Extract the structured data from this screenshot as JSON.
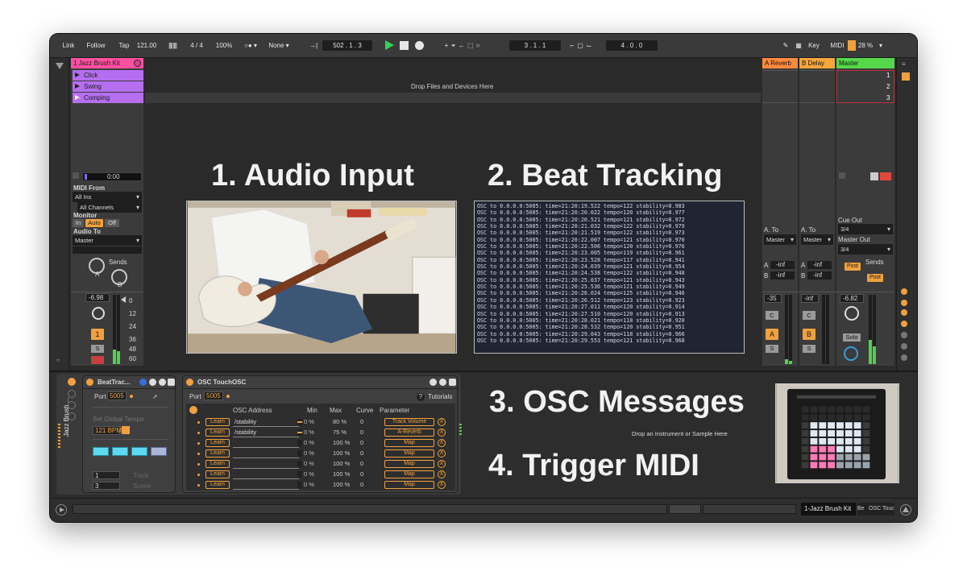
{
  "transport": {
    "link": "Link",
    "follow": "Follow",
    "tap": "Tap",
    "tempo": "121.00",
    "bars": "||||  ||||",
    "signature": "4 / 4",
    "zoom": "100%",
    "metro": "1 Bar",
    "quant": "None",
    "position": "502 .  1 .  3",
    "loop_start": "3 .  1 .  1",
    "loop_len": "4 .  0 .  0",
    "key": "Key",
    "midi": "MIDI",
    "cpu": "28 %"
  },
  "tracks": {
    "midi_track_name": "1 Jazz Brush Kit",
    "clips": [
      "Click",
      "Swing",
      "Comping"
    ],
    "drop_files": "Drop Files and Devices Here",
    "time": "0:00",
    "midi_from": "MIDI From",
    "all_ins": "All Ins",
    "all_channels": "All Channels",
    "monitor": "Monitor",
    "mon_in": "In",
    "mon_auto": "Auto",
    "mon_off": "Off",
    "audio_to": "Audio To",
    "master": "Master",
    "sends": "Sends",
    "send_a": "A",
    "send_b": "B",
    "vol": "-6.98",
    "track_num": "1",
    "solo": "S",
    "scale": [
      "0",
      "12",
      "24",
      "36",
      "48",
      "60"
    ]
  },
  "returns": {
    "a_name": "A Reverb",
    "b_name": "B Delay",
    "master_name": "Master",
    "scene_nums": [
      "1",
      "2",
      "3"
    ],
    "a_to": "A. To",
    "master": "Master",
    "inf": "-inf",
    "a_vol": "-35",
    "b_vol": "-inf",
    "master_vol": "-6.82",
    "a_letter": "A",
    "b_letter": "B",
    "c": "C",
    "s": "S",
    "cue_out": "Cue Out",
    "cue_val": "3/4",
    "master_out": "Master Out",
    "master_out_val": "3/4",
    "sends": "Sends",
    "post": "Post",
    "solo": "Solo",
    "send_a": "A",
    "send_b": "B"
  },
  "overlay": {
    "title1": "1. Audio Input",
    "title2": "2. Beat Tracking",
    "title3": "3. OSC Messages",
    "title4": "4. Trigger MIDI"
  },
  "osc_log": [
    "OSC to 0.0.0.0:5005: time=21:20:19.522 tempo=122 stability=0.983",
    "OSC to 0.0.0.0:5005: time=21:20:20.022 tempo=120 stability=0.977",
    "OSC to 0.0.0.0:5005: time=21:20:20.521 tempo=121 stability=0.972",
    "OSC to 0.0.0.0:5005: time=21:20:21.032 tempo=122 stability=0.979",
    "OSC to 0.0.0.0:5005: time=21:20:21.519 tempo=122 stability=0.973",
    "OSC to 0.0.0.0:5005: time=21:20:22.007 tempo=121 stability=0.970",
    "OSC to 0.0.0.0:5005: time=21:20:22.506 tempo=120 stability=0.976",
    "OSC to 0.0.0.0:5005: time=21:20:23.005 tempo=119 stability=0.961",
    "OSC to 0.0.0.0:5005: time=21:20:23.528 tempo=117 stability=0.941",
    "OSC to 0.0.0.0:5005: time=21:20:24.039 tempo=121 stability=0.954",
    "OSC to 0.0.0.0:5005: time=21:20:24.538 tempo=122 stability=0.948",
    "OSC to 0.0.0.0:5005: time=21:20:25.037 tempo=121 stability=0.943",
    "OSC to 0.0.0.0:5005: time=21:20:25.536 tempo=121 stability=0.949",
    "OSC to 0.0.0.0:5005: time=21:20:26.024 tempo=125 stability=0.946",
    "OSC to 0.0.0.0:5005: time=21:20:26.512 tempo=123 stability=0.923",
    "OSC to 0.0.0.0:5005: time=21:20:27.011 tempo=120 stability=0.914",
    "OSC to 0.0.0.0:5005: time=21:20:27.510 tempo=120 stability=0.913",
    "OSC to 0.0.0.0:5005: time=21:20:28.021 tempo=118 stability=0.920",
    "OSC to 0.0.0.0:5005: time=21:20:28.532 tempo=120 stability=0.951",
    "OSC to 0.0.0.0:5005: time=21:20:29.043 tempo=118 stability=0.966",
    "OSC to 0.0.0.0:5005: time=21:20:29.553 tempo=121 stability=0.968"
  ],
  "beattracker": {
    "title": "BeatTrac...",
    "port_label": "Port",
    "port": "5005",
    "set_tempo": "Set Global Tempo",
    "bpm": "121 BPM",
    "track_num": "1",
    "track_label": "Track",
    "scene_num": "3",
    "scene_label": "Scene",
    "rack_name": "Jazz Brush ..."
  },
  "touchosc": {
    "title": "OSC TouchOSC",
    "port_label": "Port",
    "port": "5005",
    "help": "?",
    "tutorials": "Tutorials",
    "headers": {
      "addr": "OSC Address",
      "min": "Min",
      "max": "Max",
      "curve": "Curve",
      "param": "Parameter"
    },
    "rows": [
      {
        "learn": "Learn",
        "addr": "/stability",
        "min": "0 %",
        "max": "80 %",
        "curve": "0",
        "param": "Track Volume",
        "x": "X"
      },
      {
        "learn": "Learn",
        "addr": "/stability",
        "min": "0 %",
        "max": "75 %",
        "curve": "0",
        "param": "A-Reverb",
        "x": "X"
      },
      {
        "learn": "Learn",
        "addr": "",
        "min": "0 %",
        "max": "100 %",
        "curve": "0",
        "param": "Map",
        "x": "X"
      },
      {
        "learn": "Learn",
        "addr": "",
        "min": "0 %",
        "max": "100 %",
        "curve": "0",
        "param": "Map",
        "x": "X"
      },
      {
        "learn": "Learn",
        "addr": "",
        "min": "0 %",
        "max": "100 %",
        "curve": "0",
        "param": "Map",
        "x": "X"
      },
      {
        "learn": "Learn",
        "addr": "",
        "min": "0 %",
        "max": "100 %",
        "curve": "0",
        "param": "Map",
        "x": "X"
      },
      {
        "learn": "Learn",
        "addr": "",
        "min": "0 %",
        "max": "100 %",
        "curve": "0",
        "param": "Map",
        "x": "X"
      }
    ]
  },
  "drop_instrument": "Drop an Instrument or Sample Here",
  "status": {
    "track": "1-Jazz Brush Kit",
    "be": "Be",
    "osc": "OSC Touc"
  },
  "colors": {
    "accent": "#f0a040",
    "midi_track": "#ff4fa0",
    "clip": "#b56ef0",
    "reverb": "#ff8a3d",
    "delay": "#f5a63c",
    "master": "#55d84a",
    "meter": "#52d04f"
  }
}
